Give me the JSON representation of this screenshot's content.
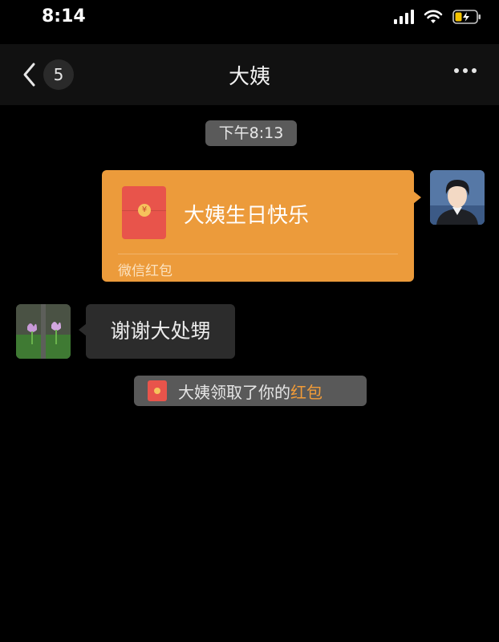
{
  "status_bar": {
    "time": "8:14",
    "icons": [
      "signal-icon",
      "wifi-icon",
      "battery-charging-icon"
    ]
  },
  "nav": {
    "back_icon": "chevron-left-icon",
    "unread_count": "5",
    "title": "大姨",
    "more_icon": "more-dots-icon"
  },
  "chat": {
    "timestamp": "下午8:13",
    "red_packet": {
      "title": "大姨生日快乐",
      "footer": "微信红包",
      "color": "#ec9b3b"
    },
    "reply": {
      "text": "谢谢大处甥"
    },
    "notice": {
      "text": "大姨领取了你的",
      "link": "红包",
      "link_color": "#f29c38"
    }
  }
}
